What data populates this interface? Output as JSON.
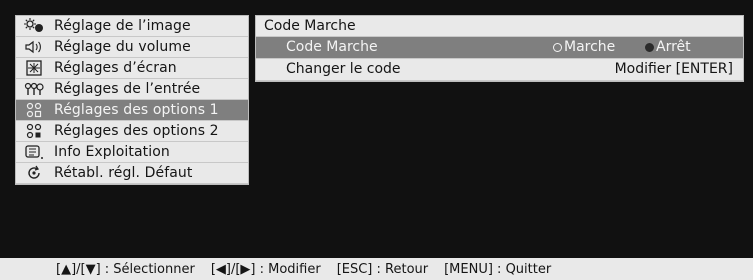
{
  "menu": {
    "items": [
      {
        "label": "Réglage de l’image",
        "icon": "image-adjust-icon"
      },
      {
        "label": "Réglage du volume",
        "icon": "speaker-icon"
      },
      {
        "label": "Réglages d’écran",
        "icon": "screen-settings-icon"
      },
      {
        "label": "Réglages de l’entrée",
        "icon": "input-icon"
      },
      {
        "label": "Réglages des options 1",
        "icon": "options-icon",
        "selected": true
      },
      {
        "label": "Réglages des options 2",
        "icon": "options-icon"
      },
      {
        "label": "Info Exploitation",
        "icon": "info-icon"
      },
      {
        "label": "Rétabl. régl. Défaut",
        "icon": "reset-icon"
      }
    ]
  },
  "panel": {
    "title": "Code Marche",
    "rows": [
      {
        "label": "Code Marche",
        "option_on": "Marche",
        "option_off": "Arrêt",
        "selected_option": "Arrêt"
      },
      {
        "label": "Changer le code",
        "value": "Modifier [ENTER]"
      }
    ]
  },
  "help": {
    "select": "[▲]/[▼] : Sélectionner",
    "modify": "[◀]/[▶] : Modifier",
    "back": "[ESC] : Retour",
    "quit": "[MENU] : Quitter"
  },
  "colors": {
    "background": "#111111",
    "menu_bg": "#e9e9e9",
    "selected_bg": "#7f7f7f",
    "text": "#151515"
  }
}
